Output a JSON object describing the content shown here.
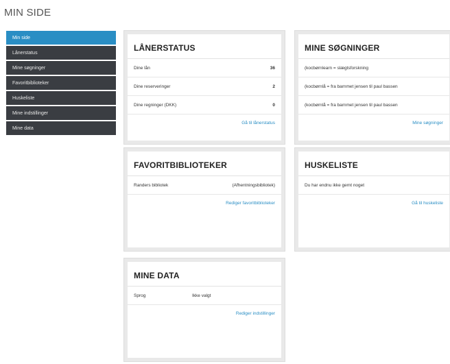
{
  "page": {
    "title": "MIN SIDE"
  },
  "sidebar": {
    "items": [
      {
        "label": "Min side",
        "active": true
      },
      {
        "label": "Lånerstatus"
      },
      {
        "label": "Mine søgninger"
      },
      {
        "label": "Favoritbiblioteker"
      },
      {
        "label": "Huskeliste"
      },
      {
        "label": "Mine indstillinger"
      },
      {
        "label": "Mine data"
      }
    ]
  },
  "lanerstatus": {
    "title": "LÅNERSTATUS",
    "rows": [
      {
        "label": "Dine lån",
        "value": "36"
      },
      {
        "label": "Dine reserveringer",
        "value": "2"
      },
      {
        "label": "Dine regninger (DKK)",
        "value": "0"
      }
    ],
    "link": "Gå til lånerstatus"
  },
  "sogninger": {
    "title": "MINE SØGNINGER",
    "rows": [
      "(kocbørnlearn = slægtsforskning",
      "(kocbørnlå = fra barnmet jensen til paul bassen",
      "(kocbørnlå = fra barnmet jensen til paul bassen"
    ],
    "link": "Mine søgninger"
  },
  "favorit": {
    "title": "FAVORITBIBLIOTEKER",
    "rows": [
      {
        "label": "Randers bibliotek",
        "value": "(Afhentningsbibliotek)"
      }
    ],
    "link": "Rediger favoritbiblioteker"
  },
  "huskeliste": {
    "title": "HUSKELISTE",
    "rows": [
      "Du har endnu ikke gemt noget"
    ],
    "link": "Gå til huskeliste"
  },
  "minedata": {
    "title": "MINE DATA",
    "rows": [
      {
        "label": "Sprog",
        "value": "Ikke valgt"
      }
    ],
    "link": "Rediger indstillinger"
  }
}
